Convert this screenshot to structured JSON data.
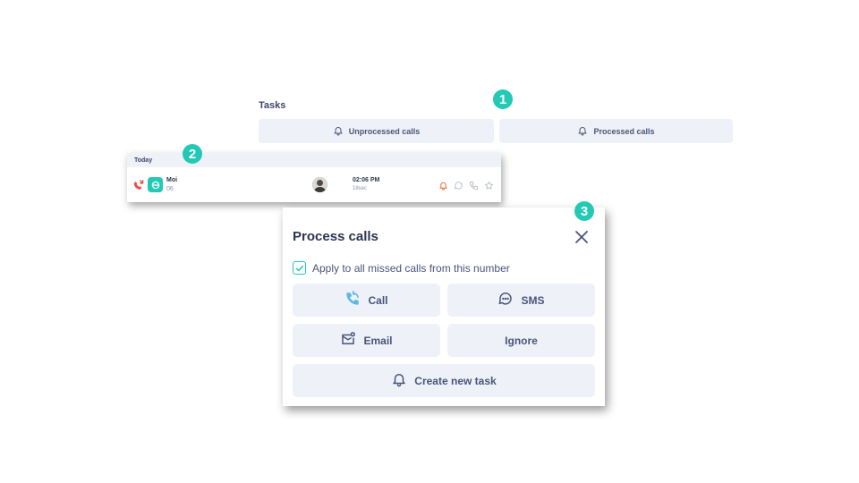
{
  "tasks": {
    "title": "Tasks",
    "unprocessed_label": "Unprocessed calls",
    "processed_label": "Processed calls"
  },
  "badges": [
    "1",
    "2",
    "3"
  ],
  "call_list": {
    "day_label": "Today",
    "row": {
      "name": "Moi",
      "number": "06",
      "time": "02:06 PM",
      "duration": "18sec"
    }
  },
  "modal": {
    "title": "Process calls",
    "apply_label": "Apply to all missed calls from this number",
    "apply_checked": true,
    "buttons": {
      "call": "Call",
      "sms": "SMS",
      "email": "Email",
      "ignore": "Ignore",
      "create_task": "Create new task"
    }
  },
  "colors": {
    "accent": "#23c9b5",
    "button_bg": "#eef1f8",
    "missed_red": "#e8524a",
    "bell_orange": "#ef6c3a",
    "modal_top_accent": "#f39c3d"
  },
  "icons": {
    "bell": "bell-icon",
    "missed_call": "missed-call-icon",
    "chat": "chat-icon",
    "phone": "phone-icon",
    "star": "star-icon",
    "close": "close-icon",
    "call_back": "call-back-icon",
    "sms": "sms-icon",
    "email": "email-icon"
  }
}
